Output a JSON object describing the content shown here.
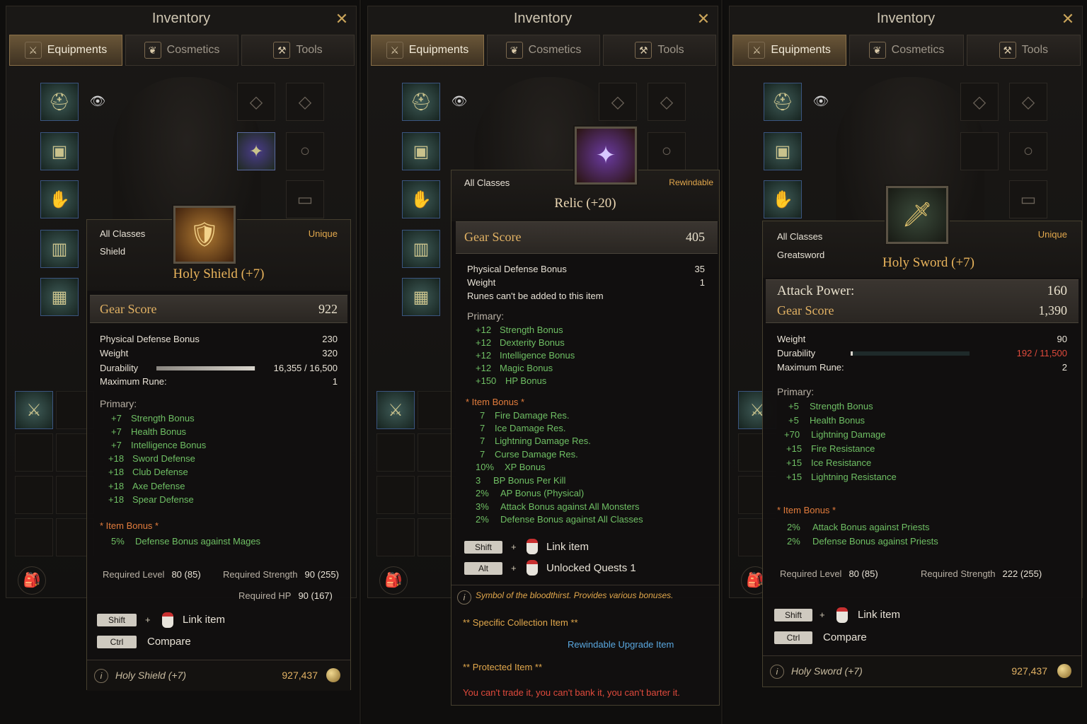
{
  "window": {
    "title": "Inventory",
    "close_icon": "close-x-icon"
  },
  "tabs": [
    {
      "label": "Equipments",
      "icon": "equipment-icon",
      "active": true
    },
    {
      "label": "Cosmetics",
      "icon": "cosmetics-icon",
      "active": false
    },
    {
      "label": "Tools",
      "icon": "tools-icon",
      "active": false
    }
  ],
  "panel1": {
    "class": "All Classes",
    "type": "Shield",
    "rarity": "Unique",
    "name": "Holy Shield (+7)",
    "gear_score_label": "Gear Score",
    "gear_score": "922",
    "stats": [
      {
        "label": "Physical Defense Bonus",
        "value": "230"
      },
      {
        "label": "Weight",
        "value": "320"
      },
      {
        "label": "Durability",
        "value": "16,355 / 16,500"
      },
      {
        "label": "Maximum Rune:",
        "value": "1"
      }
    ],
    "durability_fraction": 0.991,
    "primary_label": "Primary:",
    "primary": [
      {
        "n": "+7",
        "t": "Strength Bonus"
      },
      {
        "n": "+7",
        "t": "Health Bonus"
      },
      {
        "n": "+7",
        "t": "Intelligence Bonus"
      },
      {
        "n": "+18",
        "t": "Sword Defense"
      },
      {
        "n": "+18",
        "t": "Club Defense"
      },
      {
        "n": "+18",
        "t": "Axe Defense"
      },
      {
        "n": "+18",
        "t": "Spear Defense"
      }
    ],
    "item_bonus_label": "* Item Bonus *",
    "item_bonus": [
      {
        "n": "5%",
        "t": "Defense Bonus against Mages"
      }
    ],
    "req_level_label": "Required Level",
    "req_level": "80 (85)",
    "req_str_label": "Required Strength",
    "req_str": "90 (255)",
    "req_hp_label": "Required HP",
    "req_hp": "90 (167)",
    "key1": "Shift",
    "plus": "+",
    "hint1": "Link item",
    "key2": "Ctrl",
    "hint2": "Compare",
    "footer_name": "Holy Shield (+7)",
    "price": "927,437"
  },
  "panel2": {
    "class": "All Classes",
    "rewind": "Rewindable",
    "name": "Relic (+20)",
    "gear_score_label": "Gear Score",
    "gear_score": "405",
    "stats": [
      {
        "label": "Physical Defense Bonus",
        "value": "35"
      },
      {
        "label": "Weight",
        "value": "1"
      },
      {
        "label": "Runes can't be added to this item",
        "value": ""
      }
    ],
    "primary_label": "Primary:",
    "primary": [
      {
        "n": "+12",
        "t": "Strength Bonus"
      },
      {
        "n": "+12",
        "t": "Dexterity Bonus"
      },
      {
        "n": "+12",
        "t": "Intelligence Bonus"
      },
      {
        "n": "+12",
        "t": "Magic Bonus"
      },
      {
        "n": "+150",
        "t": "HP Bonus"
      }
    ],
    "item_bonus_label": "* Item Bonus *",
    "item_bonus": [
      {
        "n": "7",
        "t": "Fire Damage Res."
      },
      {
        "n": "7",
        "t": "Ice Damage Res."
      },
      {
        "n": "7",
        "t": "Lightning Damage Res."
      },
      {
        "n": "7",
        "t": "Curse Damage Res."
      },
      {
        "n": "10%",
        "t": "XP Bonus"
      },
      {
        "n": "3",
        "t": "BP Bonus Per Kill"
      },
      {
        "n": "2%",
        "t": "AP Bonus (Physical)"
      },
      {
        "n": "3%",
        "t": "Attack Bonus against All Monsters"
      },
      {
        "n": "2%",
        "t": "Defense Bonus against All Classes"
      }
    ],
    "key1": "Shift",
    "plus": "+",
    "hint1": "Link item",
    "key2": "Alt",
    "hint2": "Unlocked Quests 1",
    "desc": "Symbol of the bloodthirst. Provides various bonuses.",
    "collection": "** Specific Collection Item **",
    "upgrade": "Rewindable Upgrade Item",
    "protected": "** Protected Item **",
    "warning": "You can't trade it, you can't bank it, you can't barter it."
  },
  "panel3": {
    "class": "All Classes",
    "type": "Greatsword",
    "rarity": "Unique",
    "name": "Holy Sword (+7)",
    "attack_label": "Attack Power:",
    "attack": "160",
    "gear_score_label": "Gear Score",
    "gear_score": "1,390",
    "stats": [
      {
        "label": "Weight",
        "value": "90"
      },
      {
        "label": "Durability",
        "value": "192 / 11,500"
      },
      {
        "label": "Maximum Rune:",
        "value": "2"
      }
    ],
    "durability_fraction": 0.017,
    "primary_label": "Primary:",
    "primary": [
      {
        "n": "+5",
        "t": "Strength Bonus"
      },
      {
        "n": "+5",
        "t": "Health Bonus"
      },
      {
        "n": "+70",
        "t": "Lightning Damage"
      },
      {
        "n": "+15",
        "t": "Fire Resistance"
      },
      {
        "n": "+15",
        "t": "Ice Resistance"
      },
      {
        "n": "+15",
        "t": "Lightning Resistance"
      }
    ],
    "item_bonus_label": "* Item Bonus *",
    "item_bonus": [
      {
        "n": "2%",
        "t": "Attack Bonus against Priests"
      },
      {
        "n": "2%",
        "t": "Defense Bonus against Priests"
      }
    ],
    "req_level_label": "Required Level",
    "req_level": "80 (85)",
    "req_str_label": "Required Strength",
    "req_str": "222 (255)",
    "key1": "Shift",
    "plus": "+",
    "hint1": "Link item",
    "key2": "Ctrl",
    "hint2": "Compare",
    "footer_name": "Holy Sword (+7)",
    "price": "927,437"
  },
  "colors": {
    "rarity": "#e2a84c",
    "bonus": "#6fbf64",
    "warning": "#e04a3c",
    "upgrade": "#5aa8e0"
  }
}
